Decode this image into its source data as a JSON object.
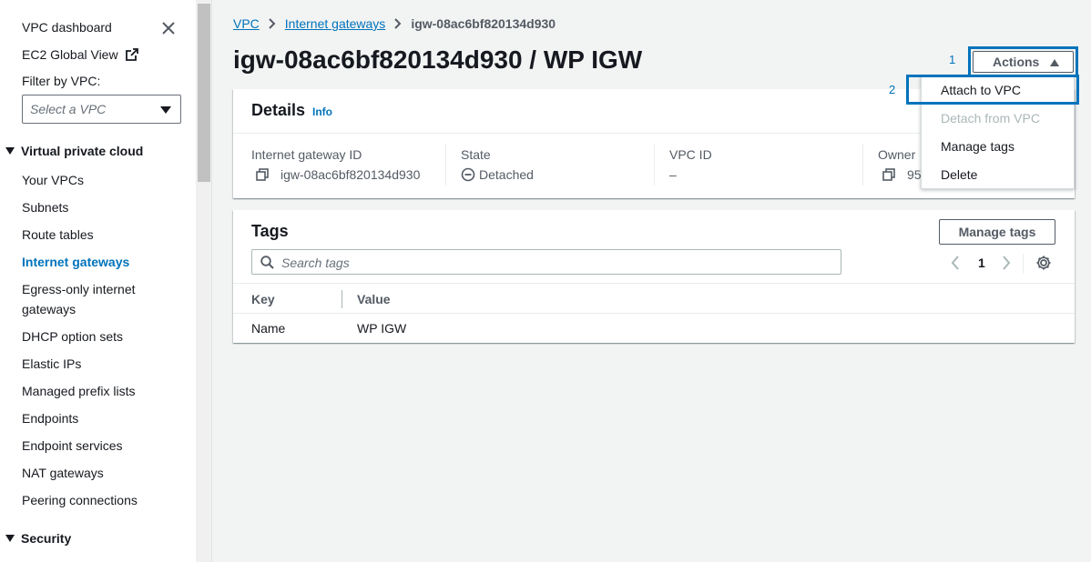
{
  "sidebar": {
    "dashboard": "VPC dashboard",
    "ec2_global_view": "EC2 Global View",
    "filter_label": "Filter by VPC:",
    "filter_placeholder": "Select a VPC",
    "section_vpc": "Virtual private cloud",
    "items": [
      "Your VPCs",
      "Subnets",
      "Route tables",
      "Internet gateways",
      "Egress-only internet",
      "gateways",
      "DHCP option sets",
      "Elastic IPs",
      "Managed prefix lists",
      "Endpoints",
      "Endpoint services",
      "NAT gateways",
      "Peering connections"
    ],
    "section_security": "Security"
  },
  "breadcrumb": {
    "vpc": "VPC",
    "internet_gateways": "Internet gateways",
    "current": "igw-08ac6bf820134d930"
  },
  "page": {
    "title": "igw-08ac6bf820134d930 / WP IGW"
  },
  "callouts": {
    "one": "1",
    "two": "2"
  },
  "actions": {
    "label": "Actions",
    "menu": [
      "Attach to VPC",
      "Detach from VPC",
      "Manage tags",
      "Delete"
    ]
  },
  "details": {
    "title": "Details",
    "info": "Info",
    "igw_label": "Internet gateway ID",
    "igw_value": "igw-08ac6bf820134d930",
    "state_label": "State",
    "state_value": "Detached",
    "vpc_label": "VPC ID",
    "vpc_value": "–",
    "owner_label": "Owner",
    "owner_value": "95"
  },
  "tags": {
    "title": "Tags",
    "manage_button": "Manage tags",
    "search_placeholder": "Search tags",
    "page_number": "1",
    "columns": [
      "Key",
      "Value"
    ],
    "rows": [
      [
        "Name",
        "WP IGW"
      ]
    ]
  },
  "colors": {
    "accent": "#0073bb",
    "sidebar_bg": "#ffffff",
    "page_bg": "#f2f3f3"
  }
}
